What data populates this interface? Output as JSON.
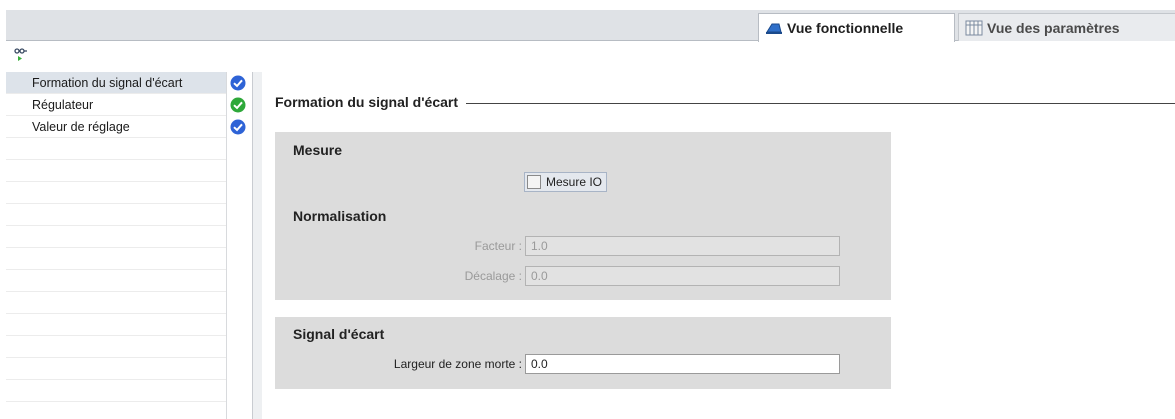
{
  "tabs": {
    "functional_view": {
      "label": "Vue fonctionnelle",
      "icon": "functional-view-icon",
      "active": true
    },
    "parameter_view": {
      "label": "Vue des paramètres",
      "icon": "parameter-view-icon",
      "active": false
    }
  },
  "nav": {
    "icon": "navigation-icon",
    "items": [
      {
        "label": "Formation du signal d'écart",
        "status": "check-blue",
        "status_color": "#2e63d6",
        "selected": true
      },
      {
        "label": "Régulateur",
        "status": "check-green",
        "status_color": "#2ea83a",
        "selected": false
      },
      {
        "label": "Valeur de réglage",
        "status": "check-blue",
        "status_color": "#2e63d6",
        "selected": false
      }
    ]
  },
  "main": {
    "section_title": "Formation du signal d'écart",
    "mesure": {
      "title": "Mesure",
      "checkbox_label": "Mesure IO",
      "checkbox_checked": false,
      "normalisation_title": "Normalisation",
      "facteur_label": "Facteur :",
      "facteur_value": "1.0",
      "decalage_label": "Décalage :",
      "decalage_value": "0.0"
    },
    "signal": {
      "title": "Signal d'écart",
      "zone_morte_label": "Largeur de zone morte :",
      "zone_morte_value": "0.0"
    }
  },
  "colors": {
    "check_blue": "#2e63d6",
    "check_green": "#2ea83a",
    "group_bg": "#dcdcdc",
    "tabbar_bg": "#dfe2e6"
  }
}
